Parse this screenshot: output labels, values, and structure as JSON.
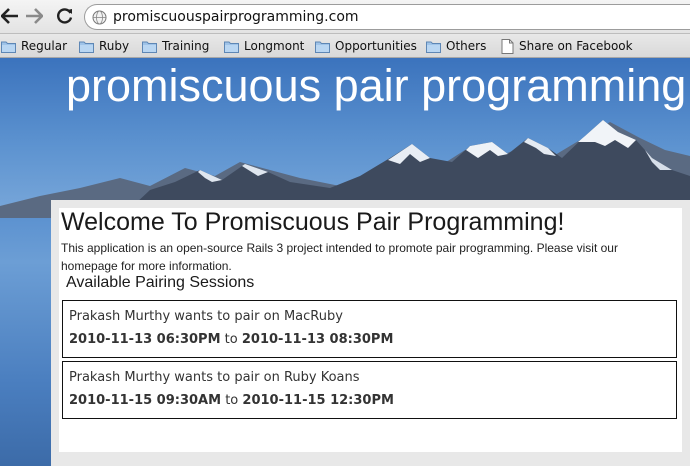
{
  "browser": {
    "url": "promiscuouspairprogramming.com"
  },
  "bookmarks": [
    {
      "label": "Regular",
      "icon": "folder-icon"
    },
    {
      "label": "Ruby",
      "icon": "folder-icon"
    },
    {
      "label": "Training",
      "icon": "folder-icon"
    },
    {
      "label": "Longmont",
      "icon": "folder-icon"
    },
    {
      "label": "Opportunities",
      "icon": "folder-icon"
    },
    {
      "label": "Others",
      "icon": "folder-icon"
    },
    {
      "label": "Share on Facebook",
      "icon": "page-icon"
    }
  ],
  "site": {
    "title": "promiscuous pair programming",
    "welcome": "Welcome To Promiscuous Pair Programming!",
    "intro": "This application is an open-source Rails 3 project intended to promote pair programming. Please visit our homepage for more information.",
    "sessions_heading": "Available Pairing Sessions",
    "sessions": [
      {
        "title": "Prakash Murthy wants to pair on MacRuby",
        "start": "2010-11-13 06:30PM",
        "connector": "to",
        "end": "2010-11-13 08:30PM"
      },
      {
        "title": "Prakash Murthy wants to pair on Ruby Koans",
        "start": "2010-11-15 09:30AM",
        "connector": "to",
        "end": "2010-11-15 12:30PM"
      }
    ]
  }
}
